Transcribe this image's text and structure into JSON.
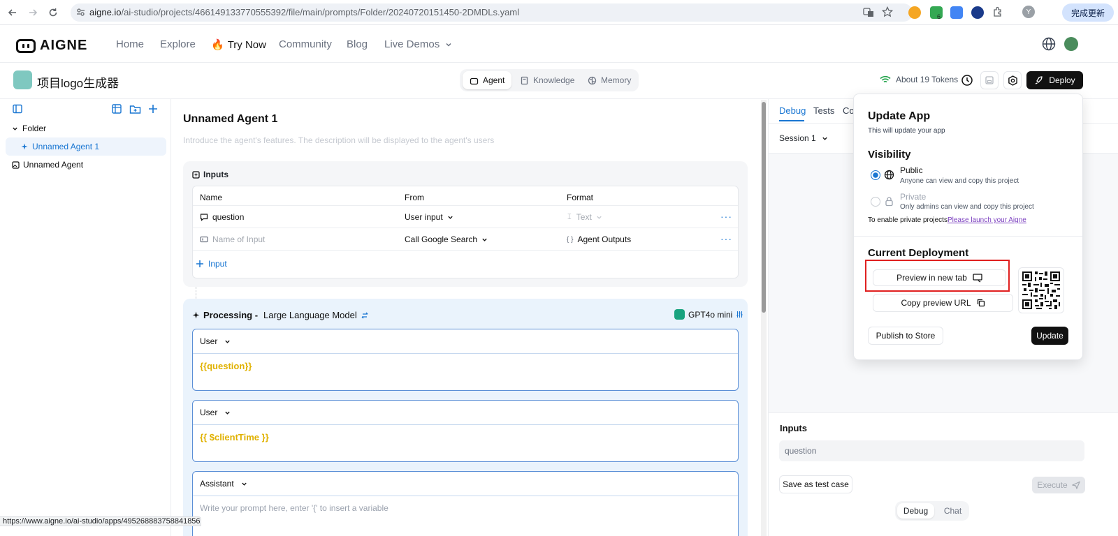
{
  "browser": {
    "url_host": "aigne.io",
    "url_path": "/ai-studio/projects/466149133770555392/file/main/prompts/Folder/20240720151450-2DMDLs.yaml",
    "update_label": "完成更新",
    "profile_initial": "Y",
    "extension_badge": "6",
    "status_url": "https://www.aigne.io/ai-studio/apps/495268883758841856"
  },
  "site": {
    "logo_text": "AIGNE",
    "nav": [
      "Home",
      "Explore",
      "Try Now",
      "Community",
      "Blog",
      "Live Demos"
    ]
  },
  "project": {
    "title": "项目logo生成器",
    "tabs": [
      "Agent",
      "Knowledge",
      "Memory"
    ],
    "tokens": "About 19 Tokens",
    "deploy_label": "Deploy"
  },
  "sidebar": {
    "folder": "Folder",
    "items": [
      "Unnamed Agent 1",
      "Unnamed Agent"
    ]
  },
  "editor": {
    "agent_title": "Unnamed Agent 1",
    "description_placeholder": "Introduce the agent's features. The description will be displayed to the agent's users",
    "inputs_label": "Inputs",
    "columns": [
      "Name",
      "From",
      "Format"
    ],
    "rows": [
      {
        "name": "question",
        "from": "User input",
        "format": "Text"
      },
      {
        "name": "Name of Input",
        "from": "Call Google Search",
        "format": "Agent Outputs"
      }
    ],
    "add_input": "Input",
    "processing_prefix": "Processing -",
    "processing_type": "Large Language Model",
    "model": "GPT4o mini",
    "messages": [
      {
        "role": "User",
        "content": "{{question}}"
      },
      {
        "role": "User",
        "content": "{{ $clientTime }}"
      },
      {
        "role": "Assistant",
        "placeholder": "Write your prompt here, enter '{' to insert a variable"
      }
    ]
  },
  "right_panel": {
    "tabs": [
      "Debug",
      "Tests",
      "Co"
    ],
    "session": "Session 1",
    "inputs_label": "Inputs",
    "question_placeholder": "question",
    "save_test": "Save as test case",
    "execute": "Execute",
    "bottom_tabs": [
      "Debug",
      "Chat"
    ]
  },
  "popup": {
    "title": "Update App",
    "subtitle": "This will update your app",
    "visibility_title": "Visibility",
    "public_label": "Public",
    "public_desc": "Anyone can view and copy this project",
    "private_label": "Private",
    "private_desc": "Only admins can view and copy this project",
    "private_note": "To enable private projects",
    "private_link": "Please launch your Aigne",
    "deployment_title": "Current Deployment",
    "preview_btn": "Preview in new tab",
    "copy_btn": "Copy preview URL",
    "publish_btn": "Publish to Store",
    "update_btn": "Update"
  },
  "colors": {
    "accent": "#1976d2",
    "variable": "#e0b100",
    "highlight_box": "#e02020"
  }
}
